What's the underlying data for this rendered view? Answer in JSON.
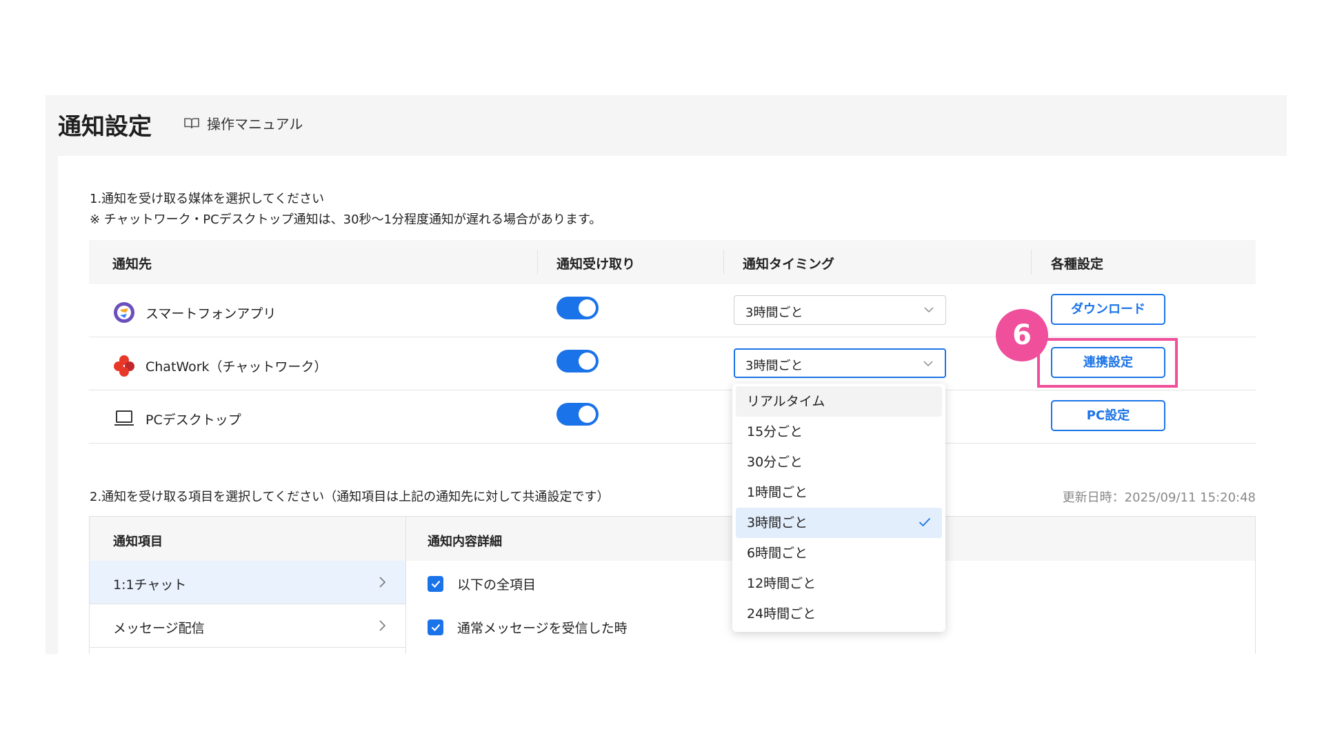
{
  "header": {
    "title": "通知設定",
    "manual_link": "操作マニュアル"
  },
  "section1": {
    "line1": "1.通知を受け取る媒体を選択してください",
    "line2": "※ チャットワーク・PCデスクトップ通知は、30秒〜1分程度通知が遅れる場合があります。"
  },
  "destinations": {
    "columns": [
      "通知先",
      "通知受け取り",
      "通知タイミング",
      "各種設定"
    ],
    "rows": [
      {
        "name": "スマートフォンアプリ",
        "enabled": true,
        "timing": "3時間ごと",
        "action": "ダウンロード",
        "icon": "app-icon"
      },
      {
        "name": "ChatWork（チャットワーク）",
        "enabled": true,
        "timing": "3時間ごと",
        "action": "連携設定",
        "icon": "chatwork-icon"
      },
      {
        "name": "PCデスクトップ",
        "enabled": true,
        "timing": "",
        "action": "PC設定",
        "icon": "laptop-icon"
      }
    ]
  },
  "timing_dropdown": {
    "options": [
      "リアルタイム",
      "15分ごと",
      "30分ごと",
      "1時間ごと",
      "3時間ごと",
      "6時間ごと",
      "12時間ごと",
      "24時間ごと"
    ],
    "selected": "3時間ごと",
    "hovered": "リアルタイム"
  },
  "section2": {
    "label": "2.通知を受け取る項目を選択してください（通知項目は上記の通知先に対して共通設定です）",
    "updated": "更新日時：2025/09/11 15:20:48"
  },
  "items": {
    "columns": [
      "通知項目",
      "通知内容詳細"
    ],
    "rows": [
      "1:1チャット",
      "メッセージ配信"
    ],
    "details": [
      "以下の全項目",
      "通常メッセージを受信した時"
    ]
  },
  "annotation": {
    "step": "6"
  },
  "colors": {
    "accent": "#1a73e8",
    "annotation": "#ef4f9b"
  }
}
